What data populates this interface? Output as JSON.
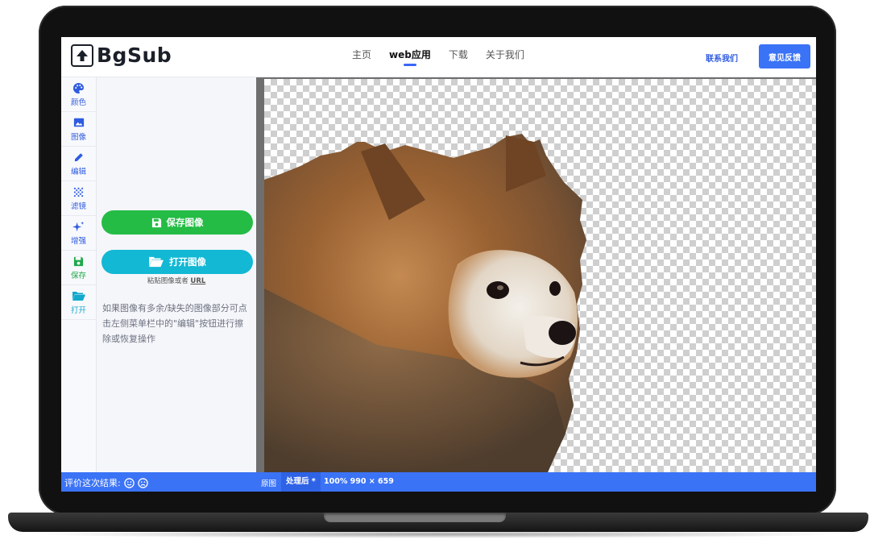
{
  "app": {
    "logo_text": "BgSub"
  },
  "nav": {
    "items": [
      {
        "label": "主页",
        "active": false
      },
      {
        "label": "web应用",
        "active": true
      },
      {
        "label": "下载",
        "active": false
      },
      {
        "label": "关于我们",
        "active": false
      }
    ],
    "contact_label": "联系我们",
    "feedback_label": "意见反馈"
  },
  "tools": [
    {
      "label": "颜色",
      "icon": "palette-icon"
    },
    {
      "label": "图像",
      "icon": "image-icon"
    },
    {
      "label": "编辑",
      "icon": "pencil-icon"
    },
    {
      "label": "滤镜",
      "icon": "filter-grid-icon"
    },
    {
      "label": "增强",
      "icon": "sparkle-icon"
    },
    {
      "label": "保存",
      "icon": "floppy-icon"
    },
    {
      "label": "打开",
      "icon": "folder-open-icon"
    }
  ],
  "panel": {
    "save_label": "保存图像",
    "open_label": "打开图像",
    "paste_prefix": "粘贴图像或者",
    "paste_url": "URL",
    "hint": "如果图像有多余/缺失的图像部分可点击左侧菜单栏中的\"编辑\"按钮进行擦除或恢复操作"
  },
  "status": {
    "rate_label": "评价这次结果:",
    "tab_original": "原图",
    "tab_processed": "处理后 *",
    "zoom_info": "100% 990 × 659"
  },
  "colors": {
    "accent_blue": "#3b73f6",
    "save_green": "#25bc46",
    "open_teal": "#12b8d4"
  }
}
